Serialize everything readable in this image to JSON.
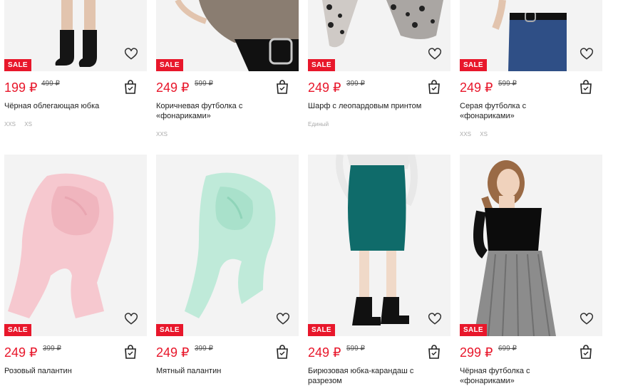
{
  "currency": "₽",
  "sale_label": "SALE",
  "products": [
    {
      "name": "Чёрная облегающая юбка",
      "price": "199 ₽",
      "old_price": "499 ₽",
      "sizes": [
        "XXS",
        "XS"
      ],
      "image": "black-skirt-legs-boots"
    },
    {
      "name": "Коричневая футболка с «фонариками»",
      "price": "249 ₽",
      "old_price": "599 ₽",
      "sizes": [
        "XXS"
      ],
      "image": "brown-top-with-belt"
    },
    {
      "name": "Шарф с леопардовым принтом",
      "price": "249 ₽",
      "old_price": "399 ₽",
      "sizes": [
        "Единый"
      ],
      "image": "leopard-scarf"
    },
    {
      "name": "Серая футболка с «фонариками»",
      "price": "249 ₽",
      "old_price": "599 ₽",
      "sizes": [
        "XXS",
        "XS"
      ],
      "image": "denim-jeans-belt"
    },
    {
      "name": "Розовый палантин",
      "price": "249 ₽",
      "old_price": "399 ₽",
      "sizes": [],
      "image": "pink-scarf"
    },
    {
      "name": "Мятный палантин",
      "price": "249 ₽",
      "old_price": "399 ₽",
      "sizes": [],
      "image": "mint-scarf"
    },
    {
      "name": "Бирюзовая юбка-карандаш с разрезом",
      "price": "249 ₽",
      "old_price": "599 ₽",
      "sizes": [],
      "image": "teal-pencil-skirt"
    },
    {
      "name": "Чёрная футболка с «фонариками»",
      "price": "299 ₽",
      "old_price": "699 ₽",
      "sizes": [],
      "image": "black-top-model"
    }
  ],
  "icons": {
    "favorite": "heart-outline-icon",
    "cart": "shopping-bag-icon"
  },
  "colors": {
    "sale": "#e8172b",
    "price": "#e8172b",
    "photo_bg": "#f3f3f3"
  }
}
